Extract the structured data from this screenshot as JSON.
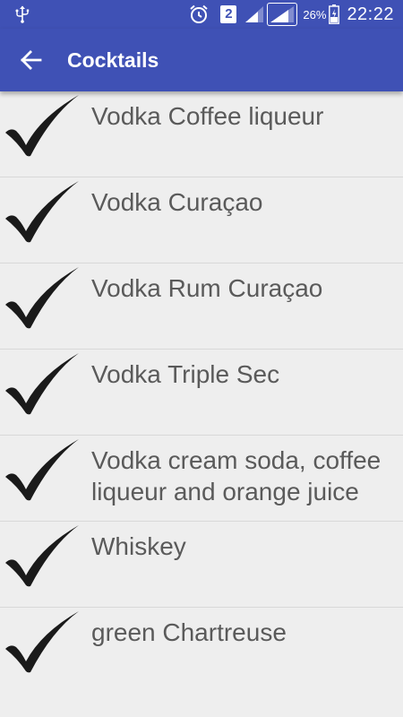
{
  "status_bar": {
    "battery_percent": "26%",
    "time": "22:22",
    "sim_slot": "2",
    "icons": [
      "usb-icon",
      "alarm-icon",
      "sim-2-icon",
      "signal-icon",
      "signal-icon",
      "battery-icon"
    ]
  },
  "app_bar": {
    "title": "Cocktails",
    "back_icon": "arrow-left-icon",
    "color": "#3f51b5"
  },
  "cocktails": [
    {
      "label": "Vodka Coffee liqueur",
      "icon": "checkmark-icon"
    },
    {
      "label": "Vodka Curaçao",
      "icon": "checkmark-icon"
    },
    {
      "label": "Vodka Rum Curaçao",
      "icon": "checkmark-icon"
    },
    {
      "label": "Vodka Triple Sec",
      "icon": "checkmark-icon"
    },
    {
      "label": "Vodka cream soda, coffee liqueur and orange juice",
      "icon": "checkmark-icon"
    },
    {
      "label": "Whiskey",
      "icon": "checkmark-icon"
    },
    {
      "label": "green Chartreuse",
      "icon": "checkmark-icon"
    }
  ]
}
